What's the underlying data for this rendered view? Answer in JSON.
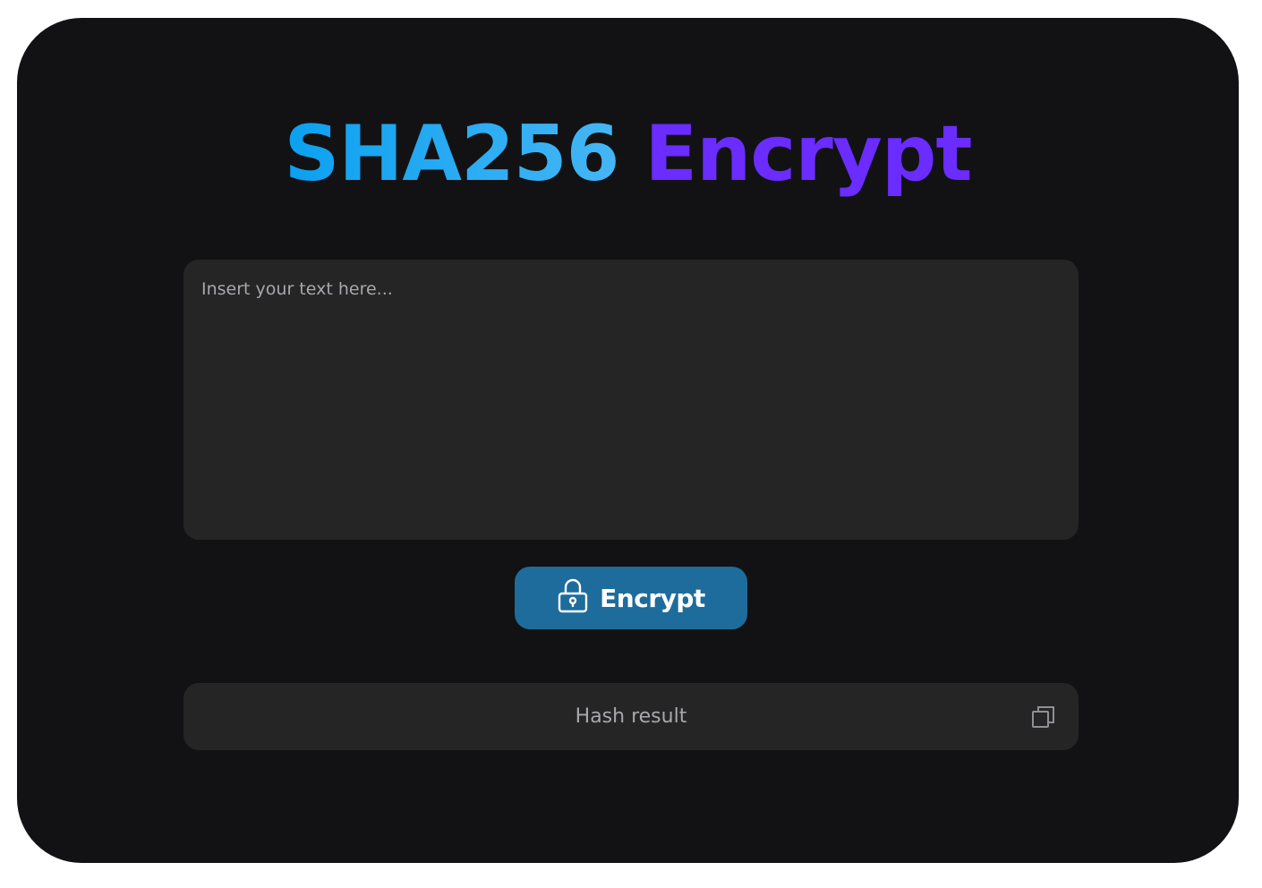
{
  "title": {
    "part1": "SHA256",
    "part2": "Encrypt"
  },
  "input": {
    "placeholder": "Insert your text here...",
    "value": ""
  },
  "encrypt_button": {
    "label": "Encrypt",
    "icon": "lock-icon"
  },
  "result": {
    "placeholder": "Hash result",
    "copy_icon": "copy-icon"
  },
  "colors": {
    "background": "#121214",
    "panel": "#252525",
    "title_part1": "#0ba0f0",
    "title_part2": "#6a2cff",
    "button": "#1d6c9c",
    "muted_text": "#a7a7ad"
  }
}
